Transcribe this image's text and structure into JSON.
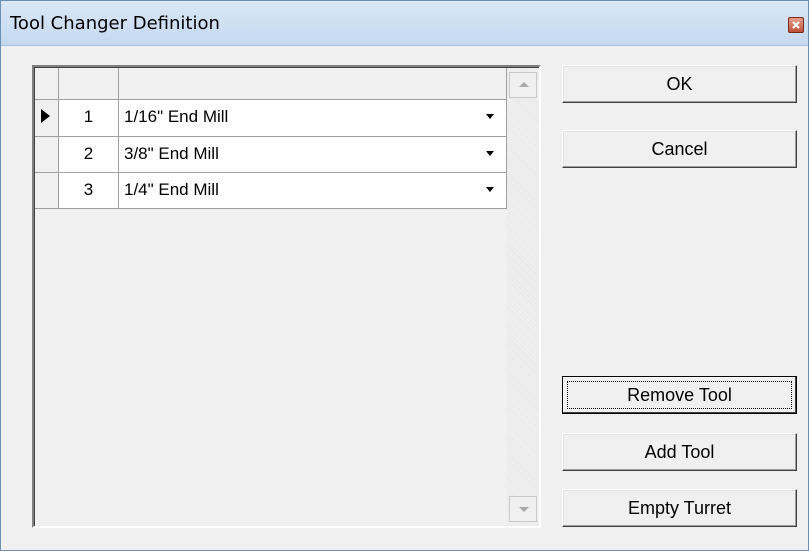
{
  "window": {
    "title": "Tool Changer Definition",
    "close_icon": "close-icon",
    "accent": "#c4d8ef"
  },
  "grid": {
    "columns": [
      "",
      "",
      ""
    ],
    "rows": [
      {
        "number": "1",
        "tool": "1/16\" End Mill",
        "current": true
      },
      {
        "number": "2",
        "tool": "3/8\" End Mill",
        "current": false
      },
      {
        "number": "3",
        "tool": "1/4\" End Mill",
        "current": false
      }
    ]
  },
  "buttons": {
    "ok": "OK",
    "cancel": "Cancel",
    "remove_tool": "Remove Tool",
    "add_tool": "Add Tool",
    "empty_turret": "Empty Turret"
  }
}
